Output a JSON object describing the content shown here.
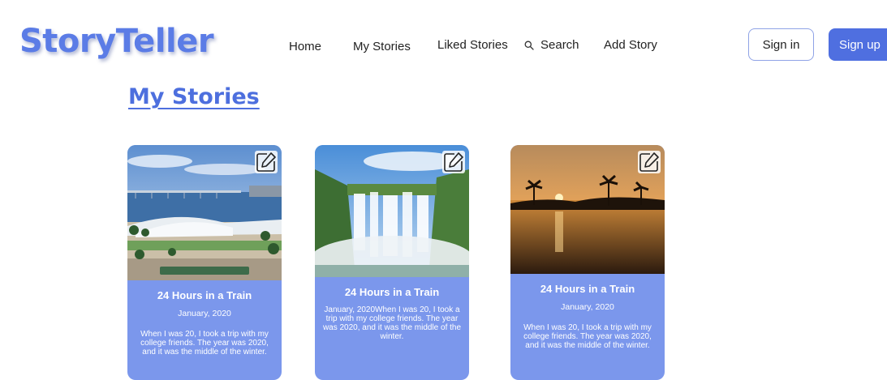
{
  "header": {
    "logo": "StoryTeller",
    "nav": {
      "home": "Home",
      "my_stories": "My Stories",
      "liked_stories": "Liked Stories",
      "search": "Search",
      "add_story": "Add Story"
    },
    "sign_in": "Sign in",
    "sign_up": "Sign up"
  },
  "page": {
    "title": "My Stories"
  },
  "stories": [
    {
      "title": "24 Hours in a Train",
      "date": "January, 2020",
      "text": "When I was 20, I took a trip with my college friends. The year was 2020, and it was the middle of the winter."
    },
    {
      "title": "24 Hours in a Train",
      "text_combined": "January, 2020When I was 20, I took a trip with my college friends. The year was 2020, and it was the middle of the winter."
    },
    {
      "title": "24 Hours in a Train",
      "date": "January, 2020",
      "text": "When I was 20, I took a trip with my college friends. The year was 2020, and it was the middle of the winter."
    }
  ],
  "icons": {
    "edit": "pencil-square-icon",
    "search": "search-icon"
  },
  "colors": {
    "brand": "#5b7ce6",
    "primary_button": "#4f6fe0",
    "card": "#7b97ec"
  }
}
